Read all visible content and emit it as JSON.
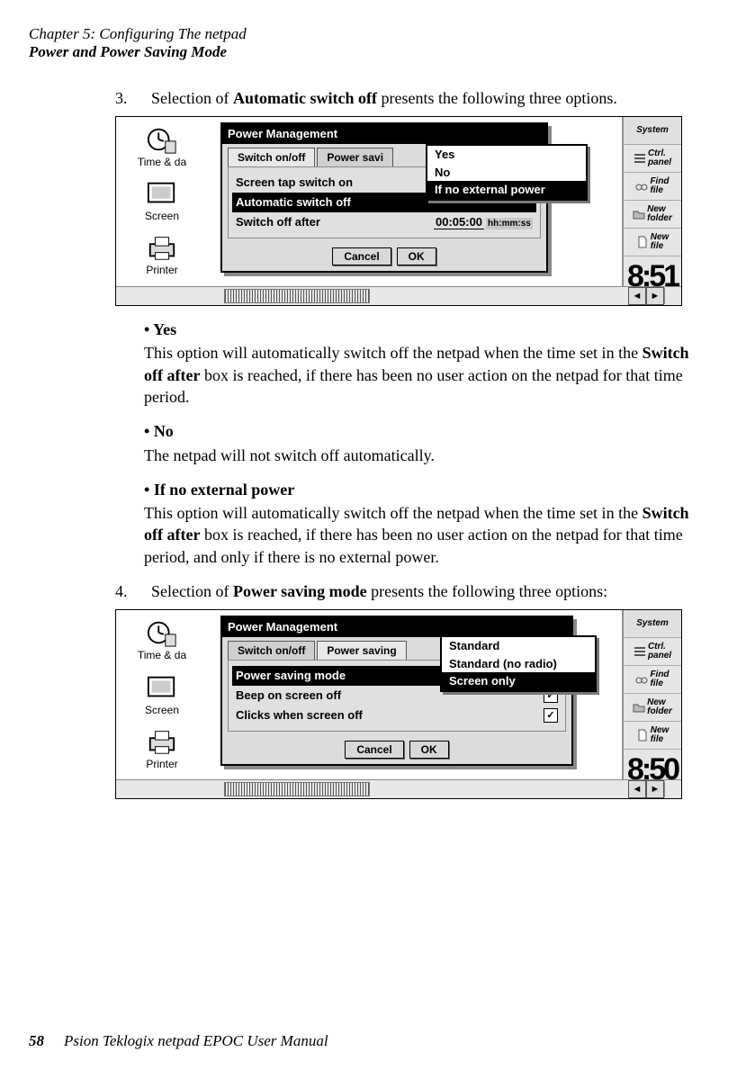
{
  "header": {
    "chapter": "Chapter 5:  Configuring The netpad",
    "section": "Power and Power Saving Mode"
  },
  "step3": {
    "num": "3.",
    "text_a": "Selection of ",
    "text_b": "Automatic switch off",
    "text_c": " presents the following three options."
  },
  "shot1": {
    "cp": {
      "time": "Time & da",
      "screen": "Screen",
      "printer": "Printer"
    },
    "sidebar": {
      "system": "System",
      "ctrl": "Ctrl.\npanel",
      "find": "Find\nfile",
      "newfolder": "New\nfolder",
      "newfile": "New\nfile",
      "clock": "8:51"
    },
    "dialog": {
      "title": "Power Management",
      "tab1": "Switch on/off",
      "tab2": "Power savi",
      "row1": "Screen tap switch on",
      "row2": "Automatic switch off",
      "row3": "Switch off after",
      "time": "00:05:00",
      "timeunit": "hh:mm:ss",
      "cancel": "Cancel",
      "ok": "OK"
    },
    "popup": {
      "opt1": "Yes",
      "opt2": "No",
      "opt3": "If no external power"
    }
  },
  "bullets1": {
    "yes_t": "Yes",
    "yes_d1": "This option will automatically switch off the netpad when the time set in the ",
    "yes_d2": "Switch off after",
    "yes_d3": " box is reached, if there has been no user action on the netpad for that time period.",
    "no_t": "No",
    "no_d": "The netpad will not switch off automatically.",
    "ext_t": "If no external power",
    "ext_d1": "This option will automatically switch off the netpad when the time set in the ",
    "ext_d2": "Switch off after",
    "ext_d3": " box is reached, if there has been no user action on the netpad for that time period, and only if there is no external power."
  },
  "step4": {
    "num": "4.",
    "text_a": "Selection of ",
    "text_b": "Power saving mode",
    "text_c": " presents the following three options:"
  },
  "shot2": {
    "cp": {
      "time": "Time & da",
      "screen": "Screen",
      "printer": "Printer"
    },
    "sidebar": {
      "system": "System",
      "ctrl": "Ctrl.\npanel",
      "find": "Find\nfile",
      "newfolder": "New\nfolder",
      "newfile": "New\nfile",
      "clock": "8:50"
    },
    "dialog": {
      "title": "Power Management",
      "tab1": "Switch on/off",
      "tab2": "Power saving",
      "row1": "Power saving mode",
      "row2": "Beep on screen off",
      "row3": "Clicks when screen off",
      "cancel": "Cancel",
      "ok": "OK",
      "chk": "✓"
    },
    "popup": {
      "opt1": "Standard",
      "opt2": "Standard (no radio)",
      "opt3": "Screen only"
    }
  },
  "footer": {
    "pagenum": "58",
    "text": "Psion Teklogix netpad EPOC User Manual"
  }
}
